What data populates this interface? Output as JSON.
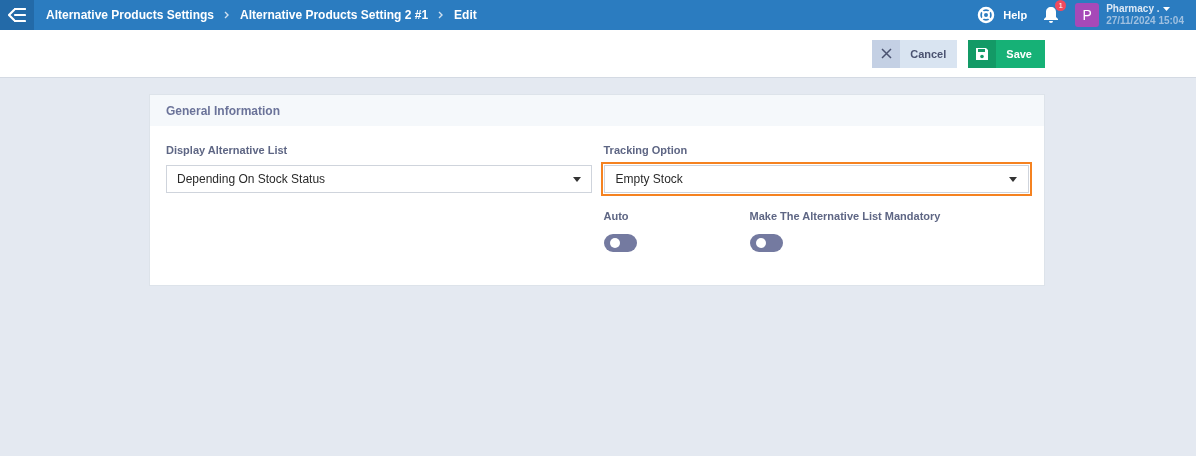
{
  "breadcrumbs": [
    {
      "label": "Alternative Products Settings"
    },
    {
      "label": "Alternative Products Setting 2 #1"
    },
    {
      "label": "Edit"
    }
  ],
  "header": {
    "help": "Help",
    "notification_count": "1",
    "avatar_letter": "P",
    "user_name": "Pharmacy .",
    "datetime": "27/11/2024 15:04"
  },
  "actions": [
    {
      "kind": "cancel",
      "label": "Cancel"
    },
    {
      "kind": "save",
      "label": "Save"
    }
  ],
  "card": {
    "title": "General Information",
    "selects": [
      {
        "label": "Display Alternative List",
        "value": "Depending On Stock Status",
        "focused": false
      },
      {
        "label": "Tracking Option",
        "value": "Empty Stock",
        "focused": true
      }
    ],
    "toggles": [
      {
        "label": "Auto",
        "on": false
      },
      {
        "label": "Make The Alternative List Mandatory",
        "on": false
      }
    ]
  }
}
